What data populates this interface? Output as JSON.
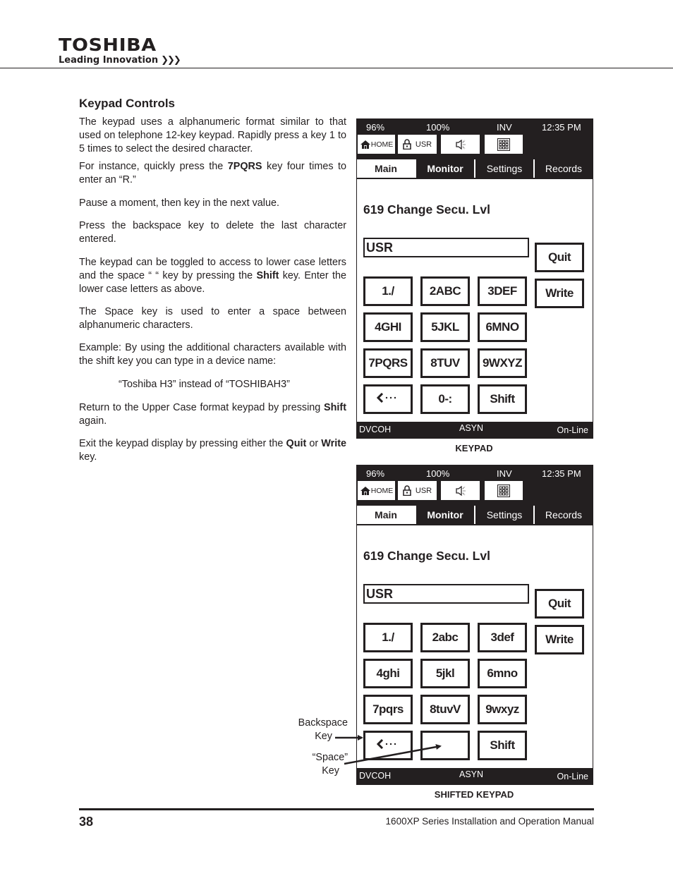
{
  "header": {
    "brand": "TOSHIBA",
    "tagline": "Leading Innovation",
    "tagline_icon": "triple-chevron-right-icon"
  },
  "section": {
    "title": "Keypad Controls",
    "paragraphs": [
      {
        "text": "The keypad uses a alphanumeric format similar to that used on telephone 12-key keypad.  Rapidly press a key 1 to 5 times to select the desired character."
      },
      {
        "pre": "For instance, quickly press the ",
        "bold": "7PQRS",
        "post": " key four times to enter an “R.”"
      },
      {
        "text": "Pause a moment, then key in the next value."
      },
      {
        "text": "Press the backspace key to delete the last character entered."
      },
      {
        "pre": "The keypad can be toggled to access to lower case letters and the space “   “ key by pressing the ",
        "bold": "Shift",
        "post": " key. Enter the lower case letters as above."
      },
      {
        "text": "The Space key is used to enter a space between alphanumeric characters."
      },
      {
        "text": "Example: By using the additional characters available with the shift key you can type in a device name:"
      },
      {
        "text": "“Toshiba H3” instead of “TOSHIBAH3”"
      },
      {
        "pre": "",
        "bold": "Shift",
        "post": " again.",
        "lead": "Return to the Upper Case format keypad by pressing "
      },
      {
        "pre": "Exit the keypad display by pressing either the ",
        "bold": "Quit",
        "post": " or ",
        "bold2": "Write",
        "post2": " key."
      }
    ]
  },
  "screens": [
    {
      "caption": "KEYPAD",
      "status": {
        "left": "96%",
        "mid": "100%",
        "right_label": "INV",
        "time": "12:35 PM"
      },
      "icon_buttons": [
        {
          "icon": "home-icon",
          "label": "HOME"
        },
        {
          "icon": "lock-icon",
          "label": "USR"
        },
        {
          "icon": "speaker-icon",
          "label": ""
        },
        {
          "icon": "keypad-grid-icon",
          "label": ""
        }
      ],
      "tabs": [
        "Main",
        "Monitor",
        "Settings",
        "Records"
      ],
      "active_tab": "Monitor",
      "param_title": "619 Change Secu. Lvl",
      "entry_value": "USR",
      "keys": [
        [
          "1./",
          "2ABC",
          "3DEF"
        ],
        [
          "4GHI",
          "5JKL",
          "6MNO"
        ],
        [
          "7PQRS",
          "8TUV",
          "9WXYZ"
        ],
        [
          "backspace",
          "0-:",
          "Shift"
        ]
      ],
      "side_buttons": [
        "Quit",
        "Write"
      ],
      "statusbar": {
        "left": "DVCOH",
        "mid": "ASYN",
        "right": "On-Line"
      }
    },
    {
      "caption": "SHIFTED KEYPAD",
      "status": {
        "left": "96%",
        "mid": "100%",
        "right_label": "INV",
        "time": "12:35 PM"
      },
      "icon_buttons": [
        {
          "icon": "home-icon",
          "label": "HOME"
        },
        {
          "icon": "lock-icon",
          "label": "USR"
        },
        {
          "icon": "speaker-icon",
          "label": ""
        },
        {
          "icon": "keypad-grid-icon",
          "label": ""
        }
      ],
      "tabs": [
        "Main",
        "Monitor",
        "Settings",
        "Records"
      ],
      "active_tab": "Monitor",
      "param_title": "619 Change Secu. Lvl",
      "entry_value": "USR",
      "keys": [
        [
          "1./",
          "2abc",
          "3def"
        ],
        [
          "4ghi",
          "5jkl",
          "6mno"
        ],
        [
          "7pqrs",
          "8tuvV",
          "9wxyz"
        ],
        [
          "backspace",
          "",
          "Shift"
        ]
      ],
      "side_buttons": [
        "Quit",
        "Write"
      ],
      "statusbar": {
        "left": "DVCOH",
        "mid": "ASYN",
        "right": "On-Line"
      }
    }
  ],
  "annotations": {
    "backspace_line1": "Backspace",
    "backspace_line2": "Key",
    "space_line1": "“Space”",
    "space_line2": "Key"
  },
  "footer": {
    "page_number": "38",
    "title": "1600XP Series Installation and Operation Manual"
  }
}
